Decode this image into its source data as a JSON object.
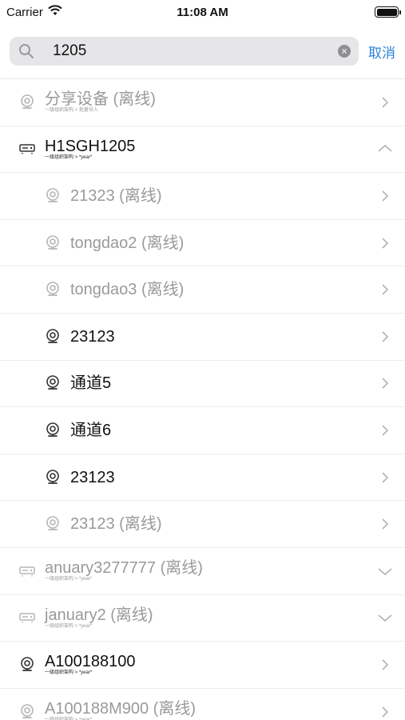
{
  "status_bar": {
    "carrier": "Carrier",
    "time": "11:08 AM"
  },
  "search": {
    "query": "1205",
    "cancel_label": "取消"
  },
  "rows": [
    {
      "kind": "top",
      "icon": "camera-icon",
      "title": "分享设备 (离线)",
      "subtitle": "一级组织架构 > 批量导入",
      "offline": true,
      "chevron": "right"
    },
    {
      "kind": "top",
      "icon": "nvr-icon",
      "title": "H1SGH1205",
      "subtitle": "一级组织架构 > *year*",
      "offline": false,
      "chevron": "up"
    },
    {
      "kind": "child",
      "icon": "camera-icon",
      "title": "21323 (离线)",
      "offline": true,
      "chevron": "right"
    },
    {
      "kind": "child",
      "icon": "camera-icon",
      "title": "tongdao2 (离线)",
      "offline": true,
      "chevron": "right"
    },
    {
      "kind": "child",
      "icon": "camera-icon",
      "title": "tongdao3 (离线)",
      "offline": true,
      "chevron": "right"
    },
    {
      "kind": "child",
      "icon": "camera-icon",
      "title": "23123",
      "offline": false,
      "chevron": "right"
    },
    {
      "kind": "child",
      "icon": "camera-icon",
      "title": "通道5",
      "offline": false,
      "chevron": "right"
    },
    {
      "kind": "child",
      "icon": "camera-icon",
      "title": "通道6",
      "offline": false,
      "chevron": "right"
    },
    {
      "kind": "child",
      "icon": "camera-icon",
      "title": "23123",
      "offline": false,
      "chevron": "right"
    },
    {
      "kind": "child",
      "icon": "camera-icon",
      "title": "23123 (离线)",
      "offline": true,
      "chevron": "right"
    },
    {
      "kind": "top",
      "icon": "nvr-icon",
      "title": "anuary3277777 (离线)",
      "subtitle": "一级组织架构 > *year*",
      "offline": true,
      "chevron": "down"
    },
    {
      "kind": "top",
      "icon": "nvr-icon",
      "title": "january2 (离线)",
      "subtitle": "一级组织架构 > *year*",
      "offline": true,
      "chevron": "down"
    },
    {
      "kind": "top",
      "icon": "camera-icon",
      "title": "A100188100",
      "subtitle": "一级组织架构 > *year*",
      "offline": false,
      "chevron": "right"
    },
    {
      "kind": "top",
      "icon": "camera-icon",
      "title": "A100188M900 (离线)",
      "subtitle": "一级组织架构 > *year*",
      "offline": true,
      "chevron": "right"
    }
  ]
}
